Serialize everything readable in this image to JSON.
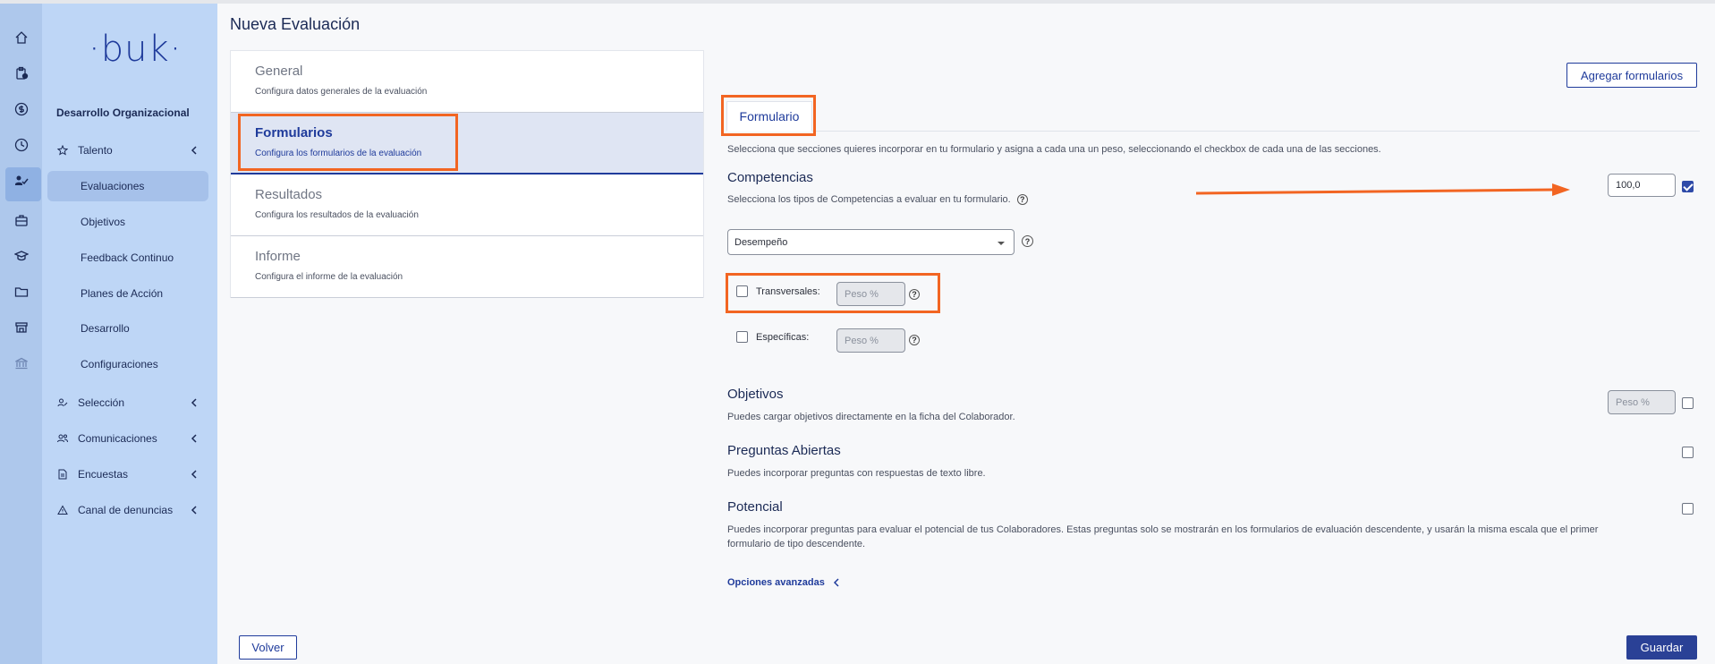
{
  "app": {
    "logo": "·buk·",
    "org_title": "Desarrollo Organizacional"
  },
  "rail_icons": [
    "home-icon",
    "clipboard-icon",
    "dollar-icon",
    "clock-icon",
    "people-icon",
    "briefcase-icon",
    "graduation-icon",
    "folder-icon",
    "store-icon",
    "bank-icon"
  ],
  "sidebar": {
    "talento": "Talento",
    "items": [
      {
        "label": "Evaluaciones"
      },
      {
        "label": "Objetivos"
      },
      {
        "label": "Feedback Continuo"
      },
      {
        "label": "Planes de Acción"
      },
      {
        "label": "Desarrollo"
      },
      {
        "label": "Configuraciones"
      }
    ],
    "seleccion": "Selección",
    "comunicaciones": "Comunicaciones",
    "encuestas": "Encuestas",
    "denuncias": "Canal de denuncias"
  },
  "page": {
    "title": "Nueva Evaluación"
  },
  "steps": [
    {
      "title": "General",
      "desc": "Configura datos generales de la evaluación"
    },
    {
      "title": "Formularios",
      "desc": "Configura los formularios de la evaluación"
    },
    {
      "title": "Resultados",
      "desc": "Configura los resultados de la evaluación"
    },
    {
      "title": "Informe",
      "desc": "Configura el informe de la evaluación"
    }
  ],
  "form": {
    "add_button": "Agregar formularios",
    "tab": "Formulario",
    "intro": "Selecciona que secciones quieres incorporar en tu formulario y asigna a cada una un peso, seleccionando el checkbox de cada una de las secciones.",
    "competencias": {
      "title": "Competencias",
      "desc": "Selecciona los tipos de Competencias a evaluar en tu formulario.",
      "weight": "100,0",
      "checked": true,
      "select_value": "Desempeño",
      "transversales": "Transversales:",
      "especificas": "Específicas:",
      "peso_placeholder": "Peso %"
    },
    "objetivos": {
      "title": "Objetivos",
      "desc": "Puedes cargar objetivos directamente en la ficha del Colaborador.",
      "peso_placeholder": "Peso %"
    },
    "preguntas": {
      "title": "Preguntas Abiertas",
      "desc": "Puedes incorporar preguntas con respuestas de texto libre."
    },
    "potencial": {
      "title": "Potencial",
      "desc1": "Puedes incorporar preguntas para evaluar el potencial de tus Colaboradores. Estas preguntas solo se mostrarán en los formularios de evaluación descendente, y usarán la misma escala que el primer",
      "desc2": "formulario de tipo descendente."
    },
    "advanced": "Opciones avanzadas"
  },
  "footer": {
    "back": "Volver",
    "save": "Guardar"
  },
  "colors": {
    "accent": "#1f3b9b",
    "highlight": "#f26522",
    "sidebar": "#bed6f6",
    "rail": "#aec8ec"
  }
}
